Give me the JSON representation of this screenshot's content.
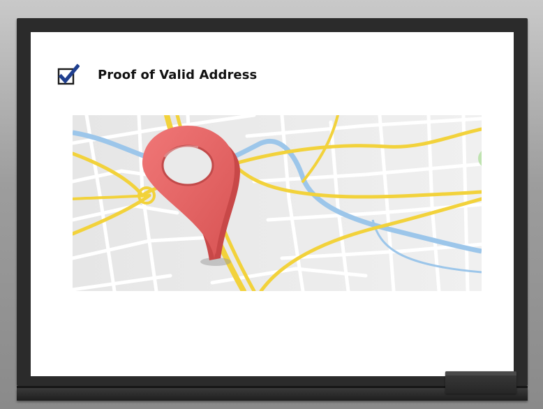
{
  "slide": {
    "heading": "Proof of Valid Address"
  },
  "icons": {
    "checkbox": "checked-checkbox-icon",
    "map_pin": "location-pin-icon"
  },
  "colors": {
    "checkbox_fill": "#1f3f8f",
    "pin_red": "#e86363",
    "road_yellow": "#f2d23b",
    "river_blue": "#9cc6ea",
    "map_bg": "#e9e9e9"
  }
}
